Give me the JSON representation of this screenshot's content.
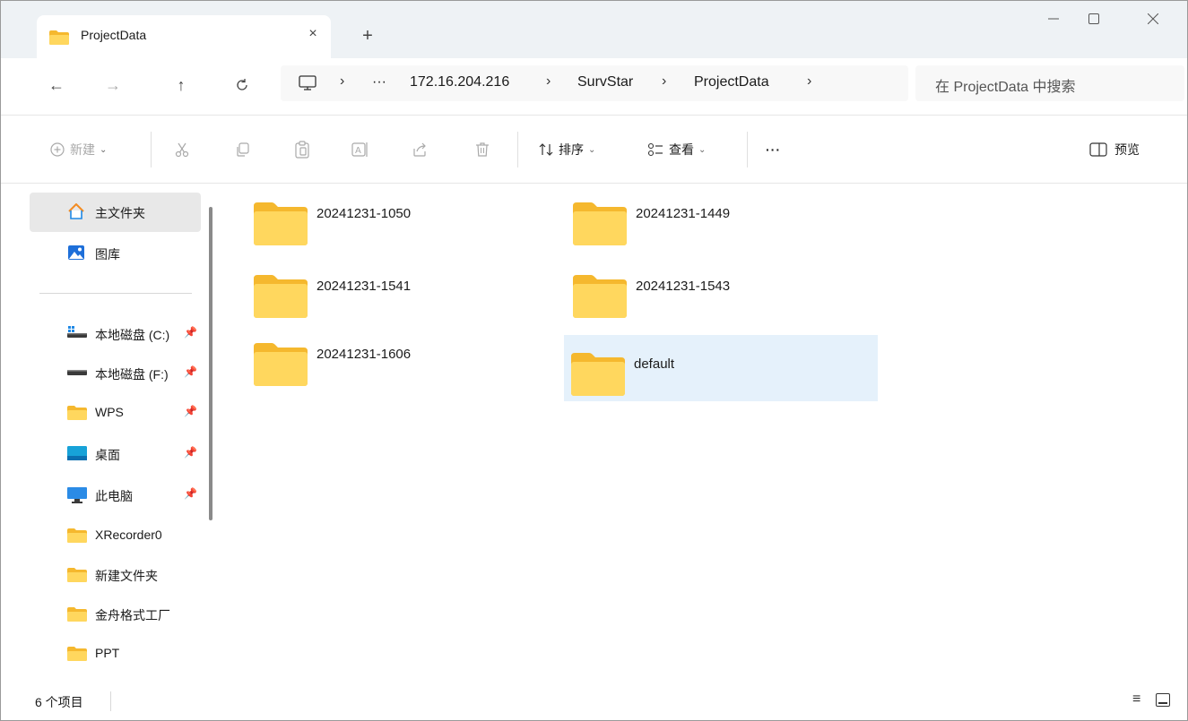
{
  "window": {
    "tab_title": "ProjectData",
    "close_tab": "×",
    "new_tab": "+",
    "minimize": "—",
    "maximize": "☐",
    "close": "✕"
  },
  "nav": {
    "back": "←",
    "forward": "→",
    "up": "↑",
    "refresh": "C",
    "ellipsis": "···",
    "separator": "›",
    "breadcrumbs": [
      "172.16.204.216",
      "SurvStar",
      "ProjectData"
    ],
    "search_placeholder": "在 ProjectData 中搜索"
  },
  "commands": {
    "new": "新建",
    "sort": "排序",
    "view": "查看",
    "more": "···",
    "preview": "预览"
  },
  "sidebar": {
    "items": [
      {
        "label": "主文件夹",
        "icon": "home-icon",
        "pinned": false,
        "selected": true
      },
      {
        "label": "图库",
        "icon": "gallery-icon",
        "pinned": false
      },
      {
        "label": "本地磁盘 (C:)",
        "icon": "drive-icon",
        "pinned": true
      },
      {
        "label": "本地磁盘 (F:)",
        "icon": "drive-icon",
        "pinned": true
      },
      {
        "label": "WPS",
        "icon": "folder-icon",
        "pinned": true
      },
      {
        "label": "桌面",
        "icon": "desktop-icon",
        "pinned": true
      },
      {
        "label": "此电脑",
        "icon": "computer-icon",
        "pinned": true
      },
      {
        "label": "XRecorder0",
        "icon": "folder-icon",
        "pinned": false
      },
      {
        "label": "新建文件夹",
        "icon": "folder-icon",
        "pinned": false
      },
      {
        "label": "金舟格式工厂",
        "icon": "folder-icon",
        "pinned": false
      },
      {
        "label": "PPT",
        "icon": "folder-icon",
        "pinned": false
      }
    ],
    "pin_glyph": "📌"
  },
  "folders": [
    {
      "name": "20241231-1050"
    },
    {
      "name": "20241231-1449"
    },
    {
      "name": "20241231-1541"
    },
    {
      "name": "20241231-1543"
    },
    {
      "name": "20241231-1606"
    },
    {
      "name": "default",
      "selected": true
    }
  ],
  "status": {
    "item_count": "6 个项目",
    "details_glyph": "≡"
  },
  "colors": {
    "folder_body": "#ffd75e",
    "folder_tab": "#f5b82e",
    "selection": "#e5f1fb",
    "accent": "#0067c0"
  }
}
